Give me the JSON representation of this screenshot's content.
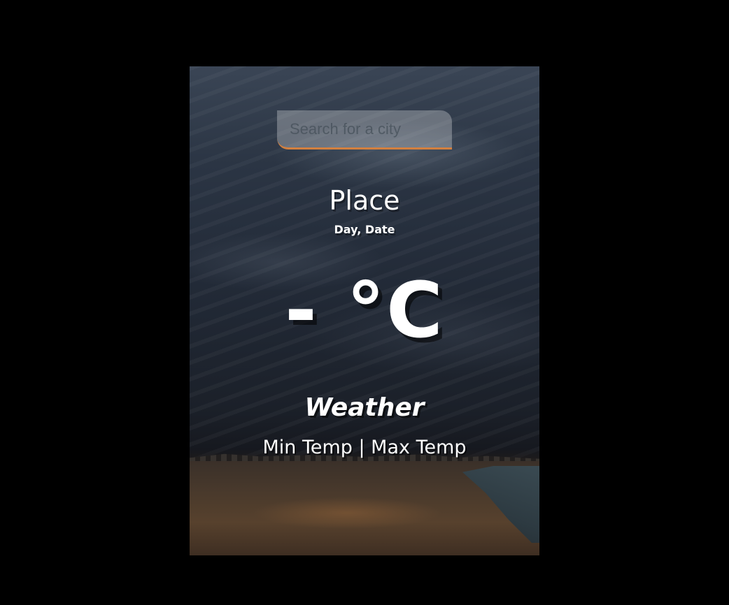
{
  "search": {
    "placeholder": "Search for a city",
    "value": ""
  },
  "location": {
    "city": "Place",
    "date": "Day, Date"
  },
  "current": {
    "temp": "-",
    "unit": "°C",
    "weather": "Weather",
    "hi_low": "Min Temp | Max Temp"
  },
  "colors": {
    "page_background": "#000000",
    "search_accent": "#d3803f",
    "text": "#ffffff"
  },
  "background_image": "stormy-sky-over-beach"
}
